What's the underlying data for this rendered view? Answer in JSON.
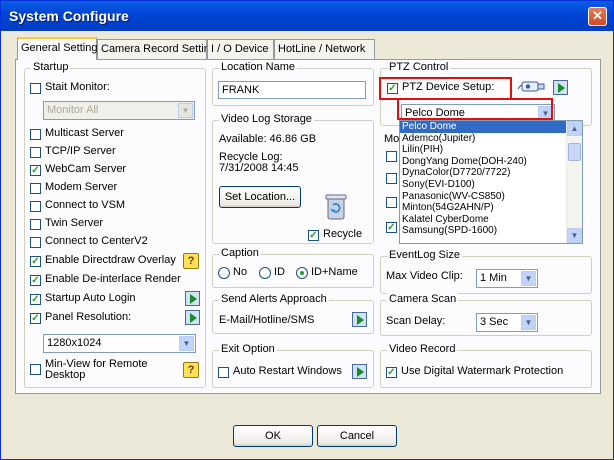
{
  "window": {
    "title": "System Configure"
  },
  "tabs": [
    "General Setting",
    "Camera Record Setting",
    "I / O Device",
    "HotLine / Network"
  ],
  "startup": {
    "legend": "Startup",
    "start_monitor": "Stait Monitor:",
    "monitor_value": "Monitor All",
    "multicast": "Multicast Server",
    "tcpip": "TCP/IP Server",
    "webcam": "WebCam Server",
    "modem": "Modem Server",
    "connect_vsm": "Connect to VSM",
    "twin": "Twin Server",
    "connect_center": "Connect to CenterV2",
    "directdraw": "Enable Directdraw Overlay",
    "deinterlace": "Enable De-interlace Render",
    "autologin": "Startup Auto Login",
    "panel_res": "Panel Resolution:",
    "resolution_value": "1280x1024",
    "minview": "Min-View for Remote Desktop"
  },
  "location": {
    "legend": "Location Name",
    "value": "FRANK"
  },
  "storage": {
    "legend": "Video Log Storage",
    "available": "Available: 46.86 GB",
    "recycle_log_label": "Recycle Log:",
    "recycle_log_date": "7/31/2008 14:45",
    "set_location": "Set Location...",
    "recycle": "Recycle"
  },
  "caption": {
    "legend": "Caption",
    "no": "No",
    "id": "ID",
    "idname": "ID+Name"
  },
  "alerts": {
    "legend": "Send Alerts Approach",
    "label": "E-Mail/Hotline/SMS"
  },
  "exit": {
    "legend": "Exit Option",
    "auto_restart": "Auto Restart Windows"
  },
  "ptz": {
    "legend": "PTZ Control",
    "device_setup": "PTZ Device Setup:",
    "selected": "Pelco Dome",
    "options": [
      "Pelco Dome",
      "Ademco(Jupiter)",
      "Lilin(PIH)",
      "DongYang Dome(DOH-240)",
      "DynaColor(D7720/7722)",
      "Sony(EVI-D100)",
      "Panasonic(WV-CS850)",
      "Minton(54G2AHN/P)",
      "Kalatel CyberDome",
      "Samsung(SPD-1600)"
    ],
    "mo_partial": "Mo"
  },
  "eventlog": {
    "legend": "EventLog Size",
    "label": "Max Video Clip:",
    "value": "1 Min"
  },
  "camscan": {
    "legend": "Camera Scan",
    "label": "Scan Delay:",
    "value": "3 Sec"
  },
  "videorecord": {
    "legend": "Video Record",
    "watermark": "Use Digital Watermark Protection"
  },
  "buttons": {
    "ok": "OK",
    "cancel": "Cancel"
  }
}
